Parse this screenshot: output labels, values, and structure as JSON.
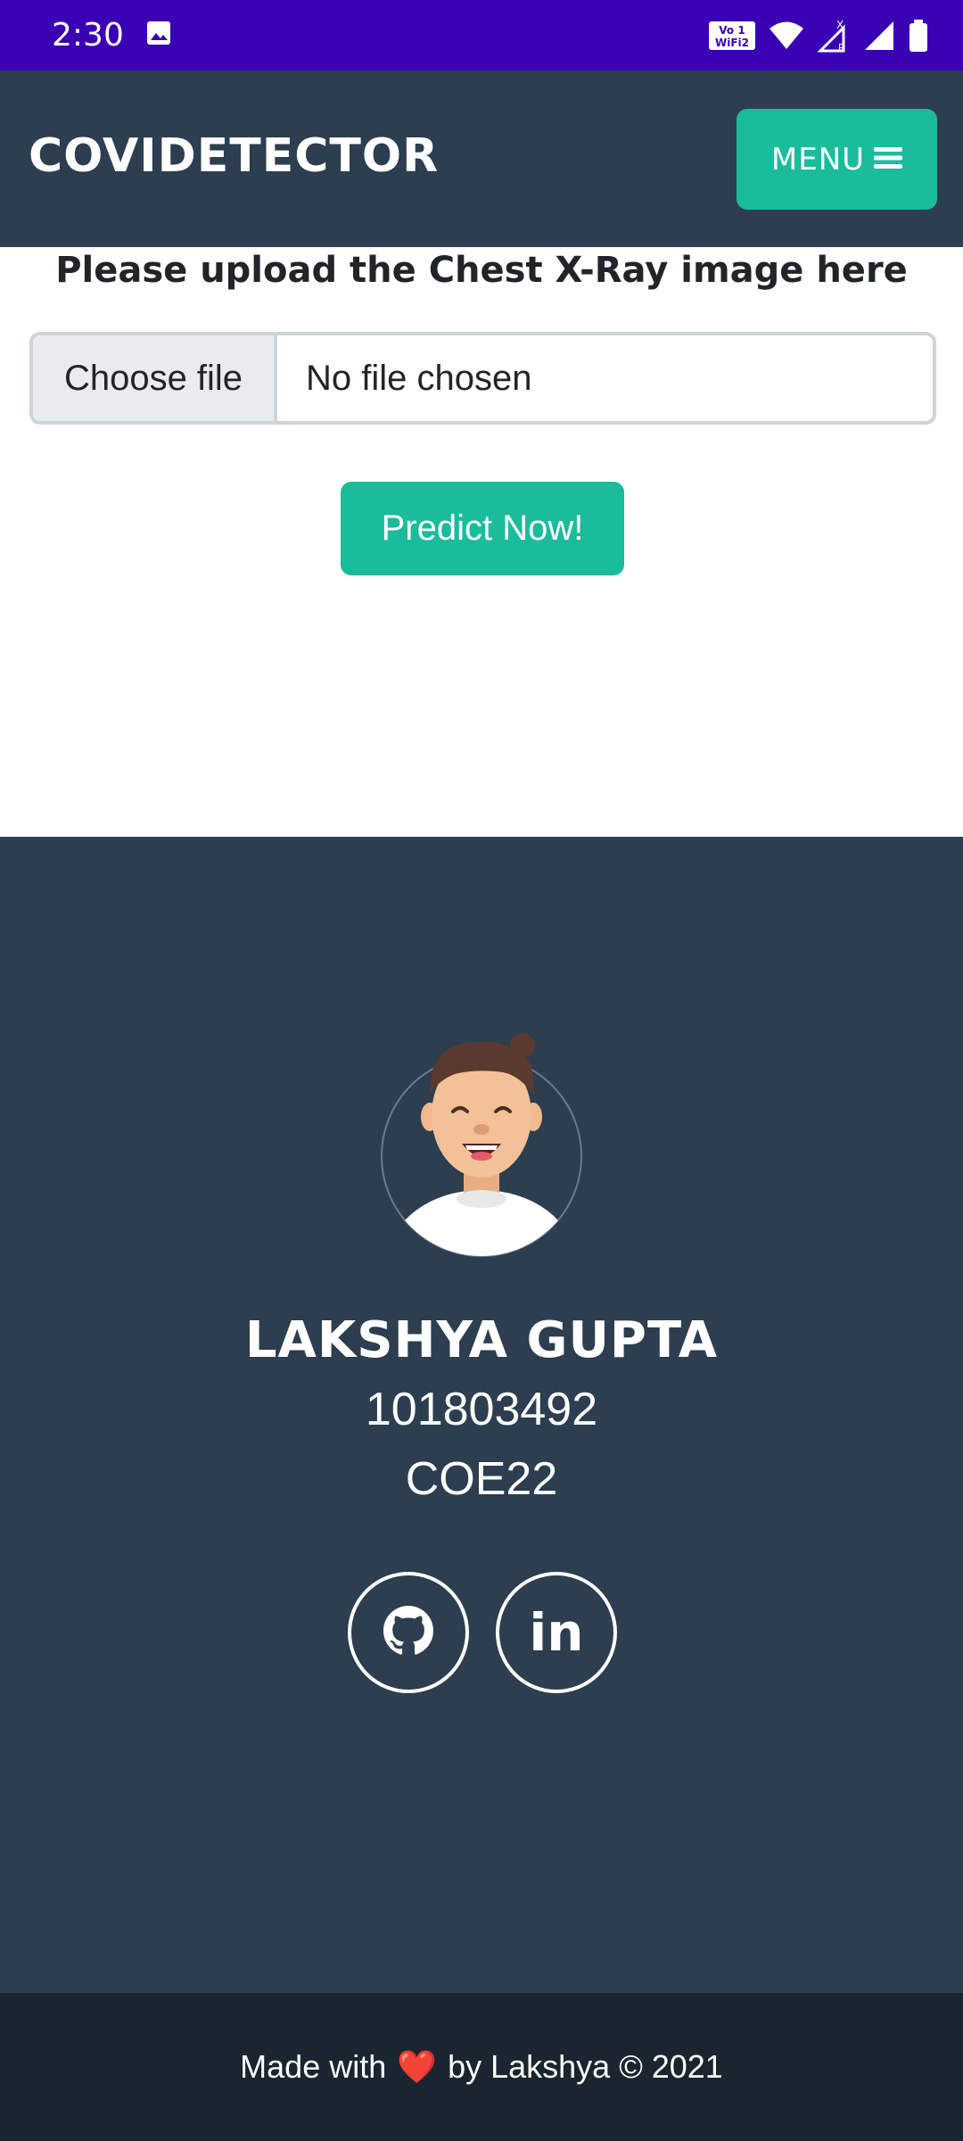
{
  "status_bar": {
    "time": "2:30",
    "icons": [
      "image-icon",
      "volte-wifi-icon",
      "wifi-icon",
      "signal-x-r-icon",
      "signal-icon",
      "battery-icon"
    ]
  },
  "navbar": {
    "brand": "COVIDETECTOR",
    "menu_label": "MENU",
    "menu_icon": "hamburger-icon",
    "accent_color": "#1abc9c",
    "background": "#2c3e50"
  },
  "upload": {
    "title": "Please upload the Chest X-Ray image here",
    "choose_file_label": "Choose file",
    "file_status": "No file chosen",
    "predict_label": "Predict Now!"
  },
  "profile": {
    "name": "LAKSHYA GUPTA",
    "id": "101803492",
    "class": "COE22",
    "social": [
      {
        "icon": "github-icon"
      },
      {
        "icon": "linkedin-icon",
        "label": "in"
      }
    ]
  },
  "footer": {
    "made_with": "Made with",
    "heart": "❤️",
    "by_text": "by Lakshya © 2021"
  }
}
